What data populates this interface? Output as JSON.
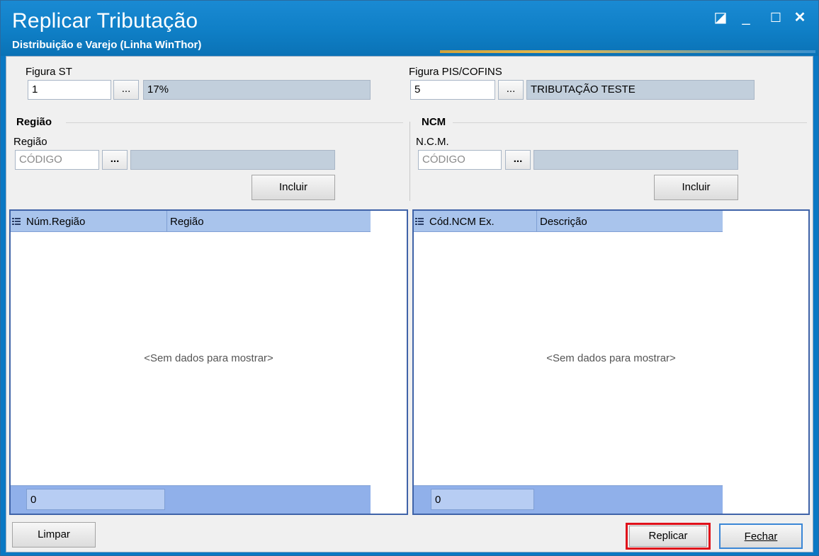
{
  "window": {
    "title": "Replicar Tributação",
    "subtitle": "Distribuição e Varejo (Linha WinThor)",
    "controls": {
      "restore": "◪",
      "minimize": "_",
      "maximize": "☐",
      "close": "✕"
    }
  },
  "top": {
    "figura_st": {
      "label": "Figura ST",
      "code": "1",
      "ellipsis": "...",
      "description": "17%"
    },
    "figura_pis": {
      "label": "Figura PIS/COFINS",
      "code": "5",
      "ellipsis": "...",
      "description": "TRIBUTAÇÃO TESTE"
    }
  },
  "regiao": {
    "section_title": "Região",
    "field_label": "Região",
    "code_placeholder": "CÓDIGO",
    "ellipsis": "...",
    "include_button": "Incluir",
    "grid": {
      "columns": [
        "Núm.Região",
        "Região"
      ],
      "empty_text": "<Sem dados para mostrar>",
      "footer_value": "0"
    }
  },
  "ncm": {
    "section_title": "NCM",
    "field_label": "N.C.M.",
    "code_placeholder": "CÓDIGO",
    "ellipsis": "...",
    "include_button": "Incluir",
    "grid": {
      "columns": [
        "Cód.NCM Ex.",
        "Descrição"
      ],
      "empty_text": "<Sem dados para mostrar>",
      "footer_value": "0"
    }
  },
  "footer": {
    "limpar": "Limpar",
    "replicar": "Replicar",
    "fechar": "Fechar"
  },
  "colors": {
    "titlebar": "#0f7fc6",
    "grid_border": "#3f63a8",
    "grid_header": "#a9c4ec",
    "highlight_box": "#e0101a"
  }
}
